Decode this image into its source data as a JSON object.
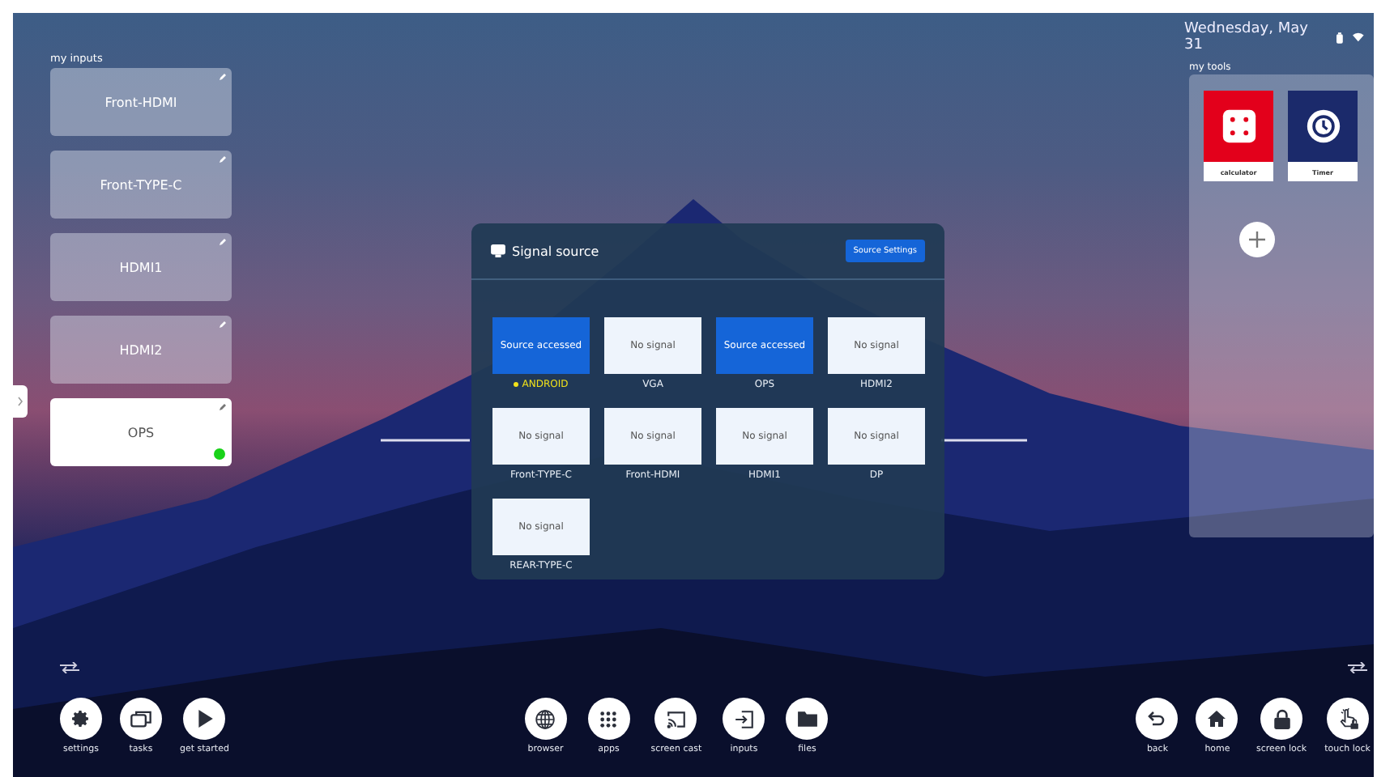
{
  "status_bar": {
    "date": "Wednesday, May 31"
  },
  "inputs": {
    "title": "my inputs",
    "items": [
      {
        "label": "Front-HDMI",
        "active": false
      },
      {
        "label": "Front-TYPE-C",
        "active": false
      },
      {
        "label": "HDMI1",
        "active": false
      },
      {
        "label": "HDMI2",
        "active": false
      },
      {
        "label": "OPS",
        "active": true
      }
    ]
  },
  "dialog": {
    "title": "Signal source",
    "button": "Source Settings",
    "sources": [
      {
        "status": "Source accessed",
        "label": "ANDROID",
        "accessed": true,
        "current": true
      },
      {
        "status": "No signal",
        "label": "VGA",
        "accessed": false,
        "current": false
      },
      {
        "status": "Source accessed",
        "label": "OPS",
        "accessed": true,
        "current": false
      },
      {
        "status": "No signal",
        "label": "HDMI2",
        "accessed": false,
        "current": false
      },
      {
        "status": "No signal",
        "label": "Front-TYPE-C",
        "accessed": false,
        "current": false
      },
      {
        "status": "No signal",
        "label": "Front-HDMI",
        "accessed": false,
        "current": false
      },
      {
        "status": "No signal",
        "label": "HDMI1",
        "accessed": false,
        "current": false
      },
      {
        "status": "No signal",
        "label": "DP",
        "accessed": false,
        "current": false
      },
      {
        "status": "No signal",
        "label": "REAR-TYPE-C",
        "accessed": false,
        "current": false
      }
    ]
  },
  "tools": {
    "title": "my tools",
    "items": [
      {
        "label": "calculator",
        "kind": "calculator",
        "color": "#e3001b"
      },
      {
        "label": "Timer",
        "kind": "timer",
        "color": "#1b2a6b"
      }
    ]
  },
  "dock": {
    "left": [
      {
        "label": "settings",
        "kind": "settings"
      },
      {
        "label": "tasks",
        "kind": "tasks"
      },
      {
        "label": "get started",
        "kind": "play"
      }
    ],
    "center": [
      {
        "label": "browser",
        "kind": "globe"
      },
      {
        "label": "apps",
        "kind": "grid"
      },
      {
        "label": "screen cast",
        "kind": "cast"
      },
      {
        "label": "inputs",
        "kind": "input"
      },
      {
        "label": "files",
        "kind": "folder"
      }
    ],
    "right": [
      {
        "label": "back",
        "kind": "back"
      },
      {
        "label": "home",
        "kind": "home"
      },
      {
        "label": "screen lock",
        "kind": "lock"
      },
      {
        "label": "touch lock",
        "kind": "touch"
      }
    ]
  }
}
